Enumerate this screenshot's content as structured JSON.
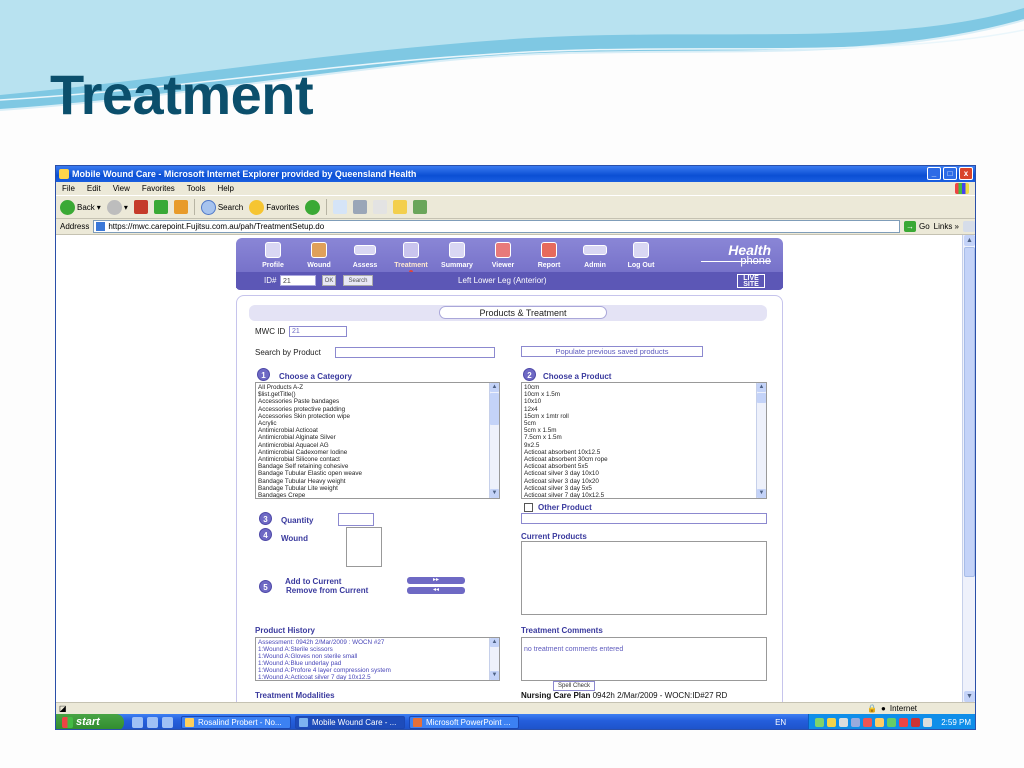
{
  "slide": {
    "title": "Treatment"
  },
  "window": {
    "title": "Mobile Wound Care - Microsoft Internet Explorer provided by Queensland Health",
    "menu": [
      "File",
      "Edit",
      "View",
      "Favorites",
      "Tools",
      "Help"
    ],
    "toolbar": {
      "back": "Back",
      "search": "Search",
      "favorites": "Favorites"
    },
    "address": {
      "label": "Address",
      "url": "https://mwc.carepoint.Fujitsu.com.au/pah/TreatmentSetup.do",
      "go": "Go",
      "links": "Links"
    },
    "status": {
      "zone": "Internet"
    }
  },
  "taskbar": {
    "start": "start",
    "tasks": [
      "Rosalind Probert - No...",
      "Mobile Wound Care - ...",
      "Microsoft PowerPoint ..."
    ],
    "lang": "EN",
    "clock": "2:59 PM"
  },
  "app": {
    "nav": [
      "Profile",
      "Wound",
      "Assess",
      "Treatment",
      "Summary",
      "Viewer",
      "Report",
      "Admin",
      "Log Out"
    ],
    "logo_main": "Health",
    "logo_sub": "phone",
    "id_label": "ID#",
    "id_value": "21",
    "ok": "OK",
    "search_btn": "Search",
    "location": "Left Lower Leg (Anterior)",
    "live": "LIVE",
    "site": "SITE",
    "panel_title": "Products & Treatment",
    "mwc_label": "MWC ID",
    "mwc_value": "21",
    "search_by_product": "Search by Product",
    "populate_btn": "Populate previous saved products",
    "step1": "Choose a Category",
    "step2": "Choose a Product",
    "step3": "Quantity",
    "step4": "Wound",
    "step5_add": "Add to Current",
    "step5_remove": "Remove from Current",
    "add_arrows": "▸▸",
    "remove_arrows": "◂◂",
    "other_product": "Other Product",
    "current_products": "Current Products",
    "product_history": "Product History",
    "treatment_comments": "Treatment Comments",
    "comments_placeholder": "no treatment comments entered",
    "spell_check": "Spell Check",
    "treatment_modalities": "Treatment Modalities",
    "care_plan_label": "Nursing Care Plan",
    "care_plan_value": "0942h 2/Mar/2009 - WOCN:ID#27 RD",
    "categories": [
      "All Products A-Z",
      "$list.getTitle()",
      "Accessories Paste bandages",
      "Accessories protective padding",
      "Accessories Skin protection wipe",
      "Acrylic",
      "Antimicrobial Acticoat",
      "Antimicrobial Alginate Silver",
      "Antimicrobial Aquacel AG",
      "Antimicrobial Cadexomer Iodine",
      "Antimicrobial Silicone contact",
      "Bandage Self retaining cohesive",
      "Bandage Tubular Elastic open weave",
      "Bandage Tubular Heavy weight",
      "Bandage Tubular Lite weight",
      "Bandages Crepe"
    ],
    "products": [
      "10cm",
      "10cm x 1.5m",
      "10x10",
      "12x4",
      "15cm x 1mtr roll",
      "5cm",
      "5cm x 1.5m",
      "7.5cm x 1.5m",
      "9x2.5",
      "Acticoat absorbent 10x12.5",
      "Acticoat absorbent 30cm rope",
      "Acticoat absorbent 5x5",
      "Acticoat silver 3 day 10x10",
      "Acticoat silver 3 day 10x20",
      "Acticoat silver 3 day 5x5",
      "Acticoat silver 7 day 10x12.5"
    ],
    "history": [
      "Assessment: 0942h 2/Mar/2009 : WOCN #27",
      "1:Wound A:Sterile scissors",
      "1:Wound A:Gloves non sterile small",
      "1:Wound A:Blue underlay pad",
      "1:Wound A:Profore 4 layer compression system",
      "1:Wound A:Acticoat silver 7 day 10x12.5"
    ]
  }
}
